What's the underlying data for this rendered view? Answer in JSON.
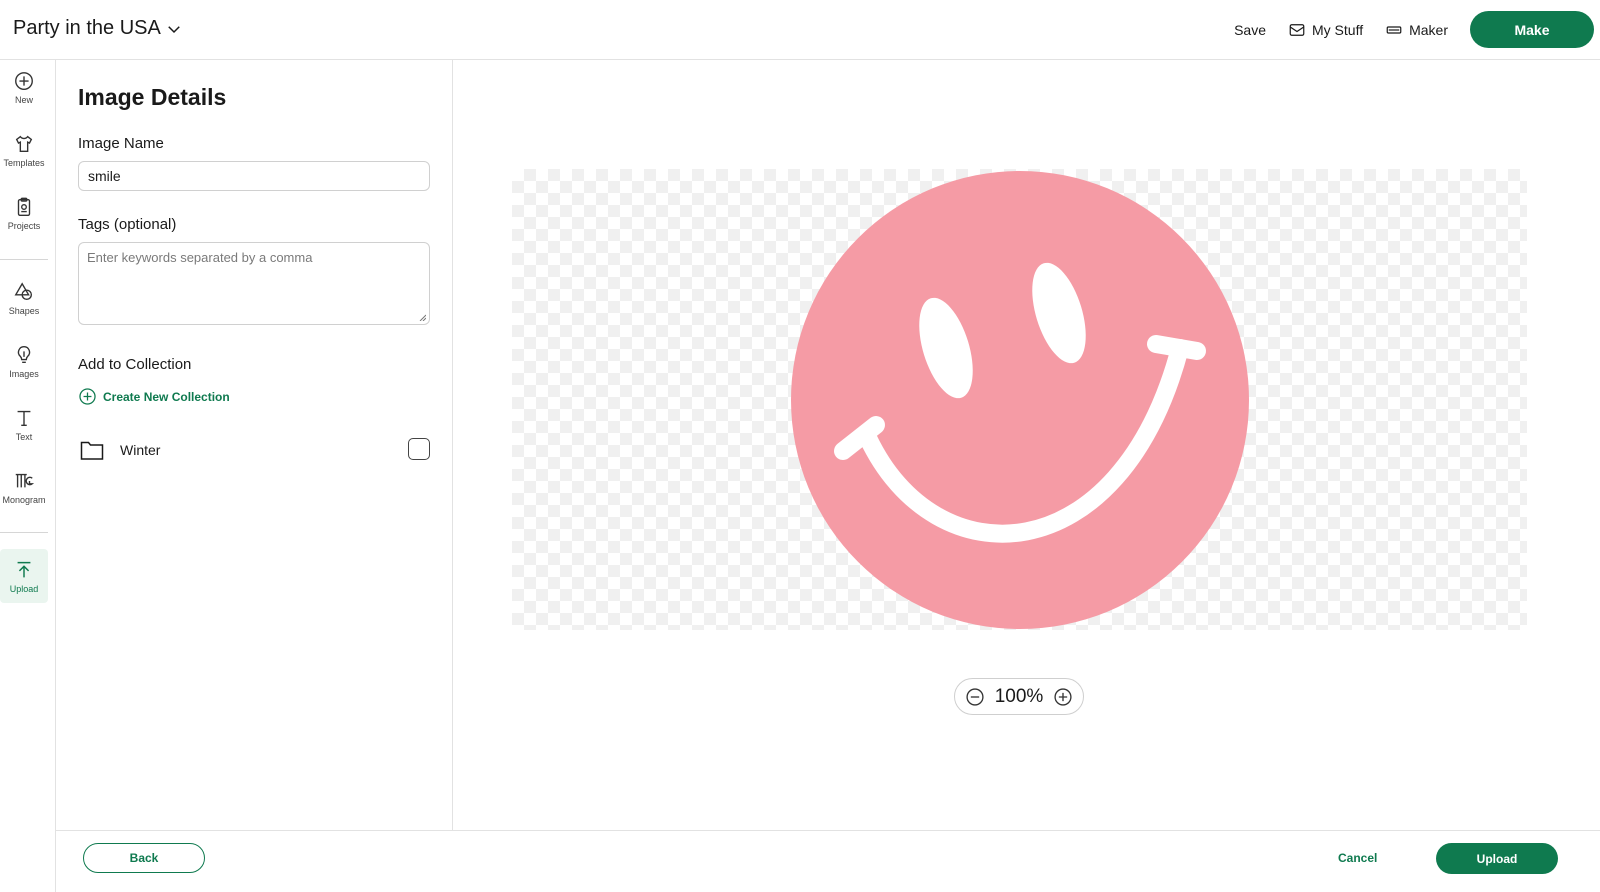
{
  "header": {
    "project_title": "Party in the USA",
    "save_label": "Save",
    "my_stuff_label": "My Stuff",
    "maker_label": "Maker",
    "make_label": "Make"
  },
  "sidebar": {
    "items": [
      {
        "label": "New",
        "icon": "plus-circle-icon"
      },
      {
        "label": "Templates",
        "icon": "shirt-icon"
      },
      {
        "label": "Projects",
        "icon": "clipboard-icon"
      },
      {
        "label": "Shapes",
        "icon": "shapes-icon"
      },
      {
        "label": "Images",
        "icon": "lightbulb-icon"
      },
      {
        "label": "Text",
        "icon": "text-icon"
      },
      {
        "label": "Monogram",
        "icon": "monogram-icon"
      },
      {
        "label": "Upload",
        "icon": "upload-icon",
        "active": true
      }
    ]
  },
  "details": {
    "title": "Image Details",
    "image_name_label": "Image Name",
    "image_name_value": "smile",
    "tags_label": "Tags (optional)",
    "tags_placeholder": "Enter keywords separated by a comma",
    "collection_label": "Add to Collection",
    "create_collection_label": "Create New Collection",
    "collections": [
      {
        "name": "Winter",
        "checked": false
      }
    ]
  },
  "preview": {
    "zoom_value": "100%",
    "image_color": "#f59ba5"
  },
  "footer": {
    "back_label": "Back",
    "cancel_label": "Cancel",
    "upload_label": "Upload"
  },
  "colors": {
    "accent": "#0f7a4f",
    "checker": "#f0f0f0"
  }
}
